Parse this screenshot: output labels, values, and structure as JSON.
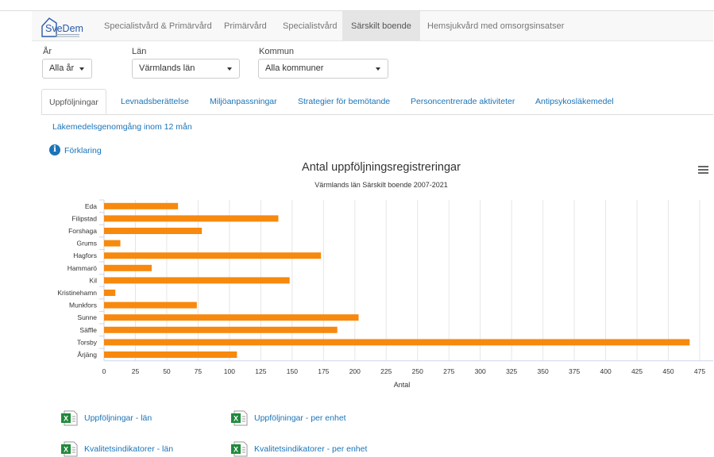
{
  "brand": {
    "name": "SveDem",
    "tagline": "Svenska registret för kognitiva/demenssjukdomar"
  },
  "nav": {
    "items": [
      {
        "label": "Specialistvård & Primärvård",
        "active": false
      },
      {
        "label": "Primärvård",
        "active": false
      },
      {
        "label": "Specialistvård",
        "active": false
      },
      {
        "label": "Särskilt boende",
        "active": true
      },
      {
        "label": "Hemsjukvård med omsorgsinsatser",
        "active": false
      }
    ]
  },
  "filters": {
    "year": {
      "label": "År",
      "value": "Alla år"
    },
    "county": {
      "label": "Län",
      "value": "Värmlands län"
    },
    "municipality": {
      "label": "Kommun",
      "value": "Alla kommuner"
    }
  },
  "tabs": [
    {
      "label": "Uppföljningar",
      "active": true
    },
    {
      "label": "Levnadsberättelse",
      "active": false
    },
    {
      "label": "Miljöanpassningar",
      "active": false
    },
    {
      "label": "Strategier för bemötande",
      "active": false
    },
    {
      "label": "Personcentrerade aktiviteter",
      "active": false
    },
    {
      "label": "Antipsykosläkemedel",
      "active": false
    },
    {
      "label": "Läkemedelsgenomgång inom 12 mån",
      "active": false
    }
  ],
  "info_link": "Förklaring",
  "downloads": [
    {
      "label": "Uppföljningar - län"
    },
    {
      "label": "Uppföljningar - per enhet"
    },
    {
      "label": "Kvalitetsindikatorer - län"
    },
    {
      "label": "Kvalitetsindikatorer - per enhet"
    }
  ],
  "colors": {
    "bar": "#f7890e",
    "link": "#1a74b8",
    "excel": "#1f8a3b"
  },
  "chart_data": {
    "type": "bar",
    "orientation": "horizontal",
    "title": "Antal uppföljningsregistreringar",
    "subtitle": "Värmlands län Särskilt boende 2007-2021",
    "xlabel": "Antal",
    "categories": [
      "Eda",
      "Filipstad",
      "Forshaga",
      "Grums",
      "Hagfors",
      "Hammarö",
      "Kil",
      "Kristinehamn",
      "Munkfors",
      "Sunne",
      "Säffle",
      "Torsby",
      "Årjäng"
    ],
    "values": [
      59,
      139,
      78,
      13,
      173,
      38,
      148,
      9,
      74,
      203,
      186,
      467,
      106
    ],
    "xlim": [
      0,
      475
    ],
    "xticks": [
      0,
      25,
      50,
      75,
      100,
      125,
      150,
      175,
      200,
      225,
      250,
      275,
      300,
      325,
      350,
      375,
      400,
      425,
      450,
      475
    ],
    "grid": true,
    "legend": false
  }
}
